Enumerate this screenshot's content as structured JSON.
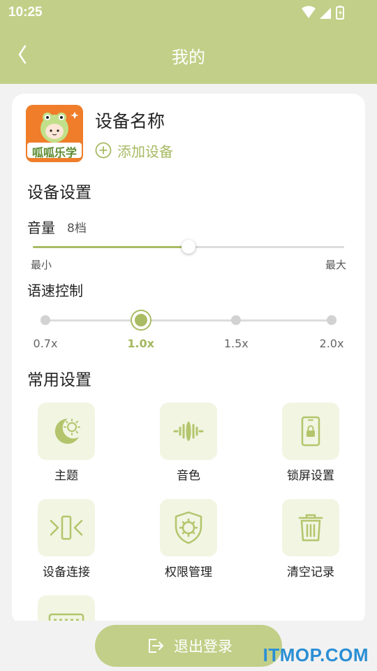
{
  "status_bar": {
    "time": "10:25"
  },
  "header": {
    "title": "我的"
  },
  "device": {
    "logo_text": "呱呱乐学",
    "name": "设备名称",
    "add_label": "添加设备"
  },
  "device_settings": {
    "title": "设备设置",
    "volume": {
      "label": "音量",
      "value_text": "8档",
      "level_fraction": 0.5,
      "min_label": "最小",
      "max_label": "最大"
    },
    "speech_speed": {
      "label": "语速控制",
      "options": [
        "0.7x",
        "1.0x",
        "1.5x",
        "2.0x"
      ],
      "selected_index": 1
    }
  },
  "common_settings": {
    "title": "常用设置",
    "items": [
      {
        "label": "主题",
        "icon": "theme-moon-sun-icon"
      },
      {
        "label": "音色",
        "icon": "soundwave-icon"
      },
      {
        "label": "锁屏设置",
        "icon": "lock-screen-icon"
      },
      {
        "label": "设备连接",
        "icon": "device-connect-icon"
      },
      {
        "label": "权限管理",
        "icon": "permission-shield-icon"
      },
      {
        "label": "清空记录",
        "icon": "trash-icon"
      },
      {
        "label": "",
        "icon": "keyboard-icon"
      }
    ]
  },
  "footer": {
    "logout_label": "退出登录"
  },
  "watermark": "ITMOP.COM",
  "colors": {
    "accent": "#c2cf88",
    "accent_dark": "#a9bb63",
    "tile_bg": "#f1f5e2",
    "logo_bg": "#ef7d2a"
  }
}
